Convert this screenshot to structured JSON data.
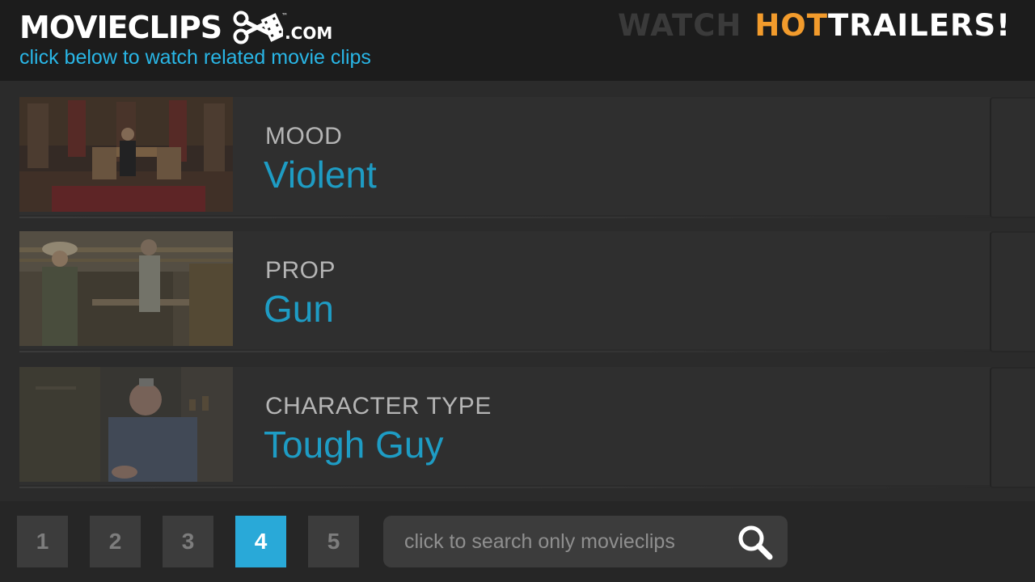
{
  "header": {
    "logo": {
      "word": "MOVIECLIPS",
      "tld": ".COM",
      "tm": "™"
    },
    "tagline": "click below to watch related movie clips",
    "promo": {
      "part1": "WATCH",
      "part2": "HOT",
      "part3": "TRAILERS!"
    }
  },
  "rows": [
    {
      "category": "MOOD",
      "value": "Violent"
    },
    {
      "category": "PROP",
      "value": "Gun"
    },
    {
      "category": "CHARACTER TYPE",
      "value": "Tough Guy"
    }
  ],
  "pagination": {
    "pages": [
      "1",
      "2",
      "3",
      "4",
      "5"
    ],
    "current": "4"
  },
  "search": {
    "placeholder": "click to search only movieclips",
    "icon": "search-icon"
  },
  "colors": {
    "accent_blue": "#29b6e6",
    "value_blue": "#1e9cc4",
    "hot_orange": "#f29b2c",
    "active_page": "#29a9d8"
  }
}
